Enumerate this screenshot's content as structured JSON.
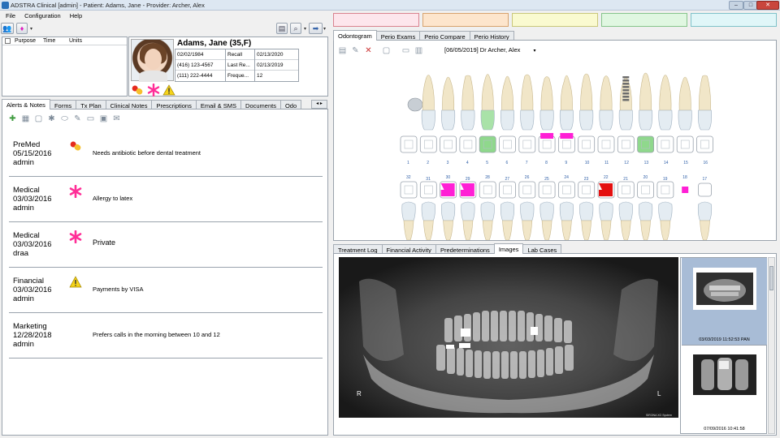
{
  "window": {
    "title": "ADSTRA Clinical [admin] - Patient: Adams, Jane - Provider: Archer, Alex",
    "minimize": "–",
    "maximize": "□",
    "close": "✕"
  },
  "menu": [
    "File",
    "Configuration",
    "Help"
  ],
  "schedule": {
    "columns": [
      "Purpose",
      "Time",
      "Units"
    ]
  },
  "patient": {
    "name": "Adams, Jane  (35,F)",
    "dob": "02/02/1984",
    "phones": [
      "(416) 123-4567",
      "(111) 222-4444"
    ],
    "fields": [
      {
        "label": "Recall",
        "value": "02/13/2020"
      },
      {
        "label": "Last Re...",
        "value": "02/13/2019"
      },
      {
        "label": "Freque...",
        "value": "12"
      }
    ]
  },
  "left_tabs": [
    "Alerts & Notes",
    "Forms",
    "Tx Plan",
    "Clinical Notes",
    "Prescriptions",
    "Email & SMS",
    "Documents",
    "Odo"
  ],
  "notes": [
    {
      "category": "PreMed",
      "date": "05/15/2016",
      "user": "admin",
      "icon": "pill-icon",
      "text": "Needs antibiotic before dental treatment"
    },
    {
      "category": "Medical",
      "date": "03/03/2016",
      "user": "admin",
      "icon": "asterisk-icon",
      "text": "Allergy to latex"
    },
    {
      "category": "Medical",
      "date": "03/03/2016",
      "user": "draa",
      "icon": "asterisk-icon",
      "text": "Private"
    },
    {
      "category": "Financial",
      "date": "03/03/2016",
      "user": "admin",
      "icon": "warning-icon",
      "text": "Payments by VISA"
    },
    {
      "category": "Marketing",
      "date": "12/28/2018",
      "user": "admin",
      "icon": "",
      "text": "Prefers calls in the morning between 10 and 12"
    }
  ],
  "color_boxes": [
    {
      "bg": "#fde6ec",
      "border": "#d9838f"
    },
    {
      "bg": "#fde5cc",
      "border": "#d7a36e"
    },
    {
      "bg": "#fafad0",
      "border": "#c9c77a"
    },
    {
      "bg": "#e0f7e1",
      "border": "#86c48b"
    },
    {
      "bg": "#e0f6f8",
      "border": "#7fc2c9"
    }
  ],
  "odo_tabs": [
    "Odontogram",
    "Perio Exams",
    "Perio Compare",
    "Perio History"
  ],
  "appointment": "[06/05/2019] Dr Archer, Alex",
  "upper_numbers": [
    "1",
    "2",
    "3",
    "4",
    "5",
    "6",
    "7",
    "8",
    "9",
    "10",
    "11",
    "12",
    "13",
    "14",
    "15",
    "16"
  ],
  "lower_numbers": [
    "32",
    "31",
    "30",
    "29",
    "28",
    "27",
    "26",
    "25",
    "24",
    "23",
    "22",
    "21",
    "20",
    "19",
    "18",
    "17"
  ],
  "colors": {
    "pink": "#ff1fd5",
    "red": "#e41010",
    "green": "#8fd88c",
    "accent": "#3060a8"
  },
  "image_tabs": [
    "Treatment Log",
    "Financial Activity",
    "Predeterminations",
    "Images",
    "Lab Cases"
  ],
  "xray_labels": {
    "left": "R",
    "right": "L",
    "brand": "SIRONA XG System"
  },
  "thumbnails": [
    {
      "caption": "03/03/2019 11:52:53 PAN"
    },
    {
      "caption": "07/09/2016 10:41:58"
    }
  ]
}
